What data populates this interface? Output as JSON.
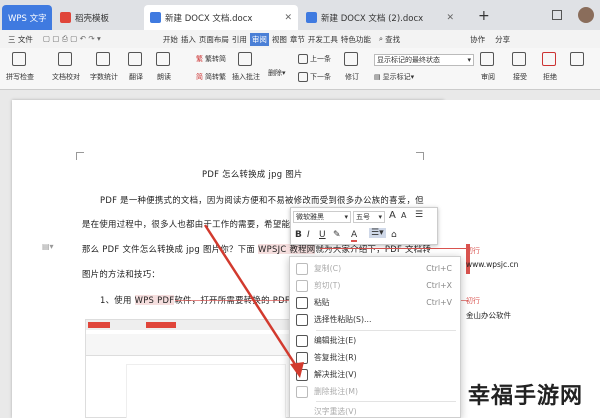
{
  "tabs": [
    {
      "label": "WPS 文字"
    },
    {
      "label": "稻壳模板"
    },
    {
      "label": "新建 DOCX 文档.docx"
    },
    {
      "label": "新建 DOCX 文档 (2).docx"
    }
  ],
  "new_tab": "+",
  "menu": {
    "file": "三 文件",
    "items": [
      "开始",
      "插入",
      "页面布局",
      "引用",
      "审阅",
      "视图",
      "章节",
      "开发工具",
      "特色功能"
    ],
    "search": "查找",
    "collab": "协作",
    "share": "分享"
  },
  "ribbon": {
    "spell": "拼写检查",
    "compare_doc": "文档校对",
    "wordcount": "字数统计",
    "translate": "翻译",
    "read": "朗读",
    "trad": "繁转简",
    "simp": "简转繁",
    "insert_comment": "插入批注",
    "delete": "删除",
    "prev": "上一条",
    "next": "下一条",
    "revise": "修订",
    "show_mode": "显示标记的最终状态",
    "show_mark": "显示标记",
    "review": "审阅",
    "accept": "接受",
    "reject": "拒绝"
  },
  "doc": {
    "title": "PDF 怎么转换成 jpg 图片",
    "p1": "PDF 是一种便携式的文档，因为阅读方便和不易被修改而受到很多办公族的喜爱，但",
    "p2": "是在使用过程中，很多人也都由于工作的需要，希望能够",
    "p3a": "那么 PDF 文件怎么转换成 jpg 图片你？下面 ",
    "p3b": "WPSJC 教程网",
    "p3c": "就为大家介绍下，PDF 文档转",
    "p4": "图片的方法和技巧：",
    "p5a": "1、使用 ",
    "p5b": "WPS PDF",
    "p5c": "软件，打开所需要转换的 PDF 文"
  },
  "mini": {
    "font": "微软雅黑",
    "size": "五号"
  },
  "context_menu": [
    {
      "label": "复制(C)",
      "shortcut": "Ctrl+C",
      "disabled": true
    },
    {
      "label": "剪切(T)",
      "shortcut": "Ctrl+X",
      "disabled": true
    },
    {
      "label": "粘贴",
      "shortcut": "Ctrl+V",
      "disabled": false
    },
    {
      "label": "选择性粘贴(S)...",
      "shortcut": "",
      "disabled": false
    },
    {
      "label": "编辑批注(E)",
      "shortcut": "",
      "disabled": false
    },
    {
      "label": "答复批注(R)",
      "shortcut": "",
      "disabled": false
    },
    {
      "label": "解决批注(V)",
      "shortcut": "",
      "disabled": false
    },
    {
      "label": "删除批注(M)",
      "shortcut": "",
      "disabled": true
    },
    {
      "label": "汉字重选(V)",
      "shortcut": "",
      "disabled": true
    }
  ],
  "comments": [
    {
      "author": "初行",
      "text": "www.wpsjc.cn"
    },
    {
      "author": "初行",
      "text": "金山办公软件"
    }
  ],
  "watermark": "幸福手游网",
  "colors": {
    "accent": "#d9534f",
    "tab_active": "#ffffff",
    "ribbon_active": "#4a7fd6"
  }
}
